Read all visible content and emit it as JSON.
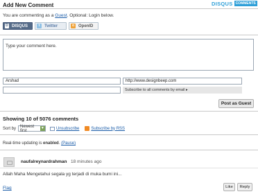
{
  "header": {
    "title": "Add New Comment",
    "brand_name": "DISQUS",
    "brand_badge": "COMMENTS"
  },
  "login": {
    "status_prefix": "You are commenting as a",
    "guest_link": "Guest",
    "status_suffix": ". Optional: Login below.",
    "buttons": [
      {
        "label": "DISQUS",
        "icon": "disqus-icon"
      },
      {
        "label": "Twitter",
        "icon": "twitter-icon"
      },
      {
        "label": "OpenID",
        "icon": "openid-icon"
      }
    ]
  },
  "form": {
    "comment_text": "Type your comment here.",
    "name_value": "Arshad",
    "website_value": "http://www.designbeep.com",
    "email_value": "",
    "subscribe_label": "Subscribe to all comments by email ▸",
    "post_button": "Post as Guest"
  },
  "comments": {
    "count_title": "Showing 10 of 5076 comments",
    "sort_label": "Sort by",
    "sort_value": "Newest first",
    "unsubscribe_label": "Unsubscribe",
    "rss_label": "Subscribe by RSS",
    "realtime_prefix": "Real-time updating is",
    "realtime_state": "enabled",
    "realtime_pause": "(Pause)",
    "items": [
      {
        "author": "naufalreynardrahman",
        "time": "18 minutes ago",
        "text": "Allah Maha Mengetahui segala yg terjadi di muka bumi ini...",
        "flag_label": "Flag",
        "like_label": "Like",
        "reply_label": "Reply"
      }
    ]
  },
  "colors": {
    "brand": "#2e9fd8",
    "disqus_button": "#556b88",
    "link": "#1a5ca8"
  }
}
